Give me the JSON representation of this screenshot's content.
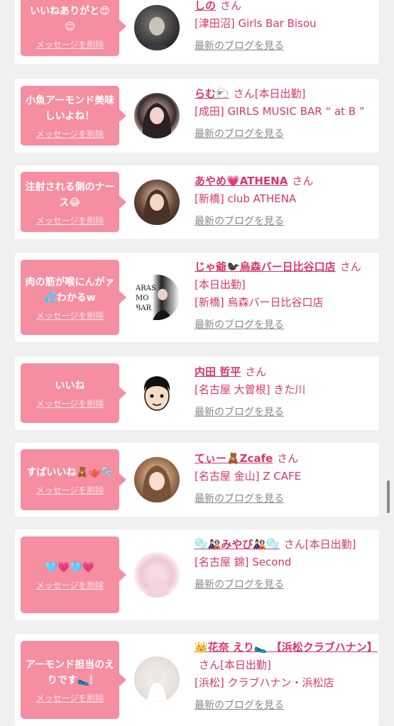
{
  "colors": {
    "background": "#f0f0f0",
    "bubble": "#f58ea0",
    "accent": "#d6376b",
    "muted": "#888888"
  },
  "delete_label": "メッセージを削除",
  "blog_label": "最新のブログを見る",
  "san_label": "さん",
  "items": [
    {
      "message": "いいねありがと😍😊",
      "name": "しの",
      "status": "",
      "shop": "[津田沼] Girls Bar Bisou",
      "avatar_icon": "profile-photo"
    },
    {
      "message": "小魚アーモンド美味しいよね！",
      "name": "らむ🐑",
      "status": "[本日出勤]",
      "shop": "[成田] GIRLS MUSIC BAR “ at B ”",
      "avatar_icon": "profile-photo"
    },
    {
      "message": "注射される側のナース😂",
      "name": "あやめ💗ATHENA",
      "status": "",
      "shop": "[新橋] club ATHENA",
      "avatar_icon": "profile-photo"
    },
    {
      "message": "肉の筋が喉にんがァ💦わかるw",
      "name": "じゃ爺🐦‍⬛烏森バー日比谷口店",
      "status": "[本日出勤]",
      "shop": "[新橋] 烏森バー日比谷口店",
      "avatar_icon": "profile-photo"
    },
    {
      "message": "いいね",
      "name": "内田 哲平",
      "status": "",
      "shop": "[名古屋 大曽根] きた川",
      "avatar_icon": "cartoon-face"
    },
    {
      "message": "すばいいね🧸🫖🫧",
      "name": "てぃー🧸Zcafe",
      "status": "",
      "shop": "[名古屋 金山] Z CAFE",
      "avatar_icon": "profile-photo"
    },
    {
      "message": "🩵💗🩵💗",
      "name": "🫧🎎みやび🎎🫧",
      "status": "[本日出勤]",
      "shop": "[名古屋 錦] Second",
      "avatar_icon": "profile-photo"
    },
    {
      "message": "アーモンド担当のえりです🥿🕯",
      "name": "👑花奈 えり🥿 【浜松クラブハナン】",
      "status": "[本日出勤]",
      "shop": "[浜松] クラブハナン・浜松店",
      "avatar_icon": "profile-photo"
    }
  ]
}
